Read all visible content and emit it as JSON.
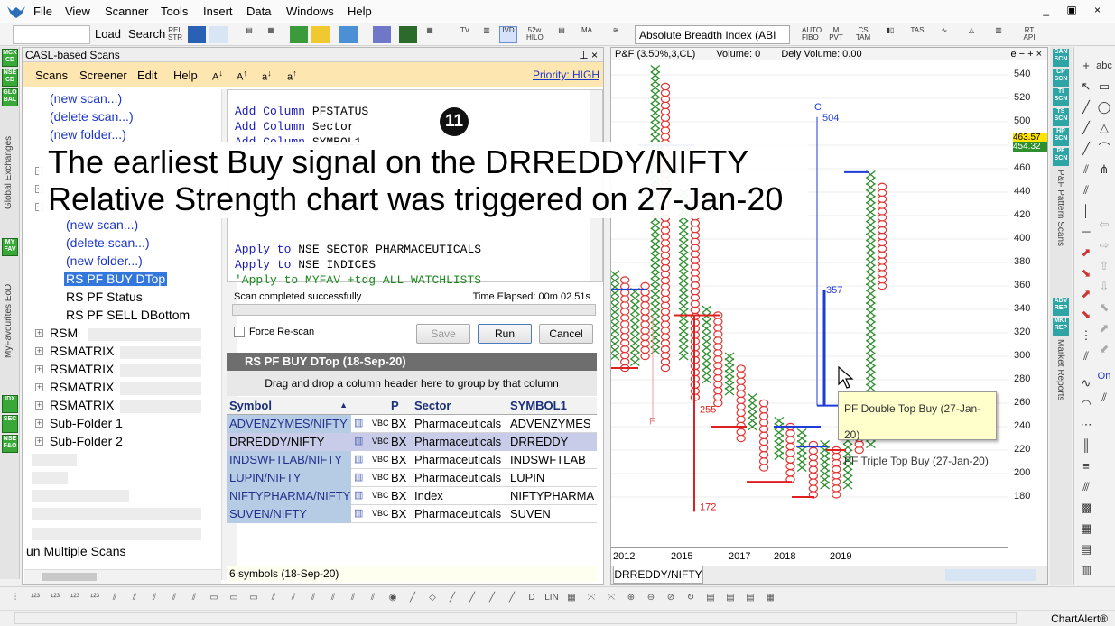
{
  "app": {
    "menu": [
      "File",
      "View",
      "Scanner",
      "Tools",
      "Insert",
      "Data",
      "Windows",
      "Help"
    ],
    "window_controls": "_ ▣ ×",
    "status_text": "ChartAlert®"
  },
  "toolbar": {
    "load_label": "Load",
    "search_label": "Search",
    "formula_value": "Absolute Breadth Index (ABI"
  },
  "left_strip": {
    "badges": [
      "MCX CD",
      "NSE CD",
      "GLO BAL",
      "MY FAV",
      "IDX",
      "SEC",
      "NSE F&O"
    ],
    "vertical_labels": [
      "Global Exchanges",
      "MyFavourites EoD"
    ]
  },
  "casl": {
    "panel_title": "CASL-based Scans",
    "menu": [
      "Scans",
      "Screener",
      "Edit",
      "Help"
    ],
    "priority": "Priority: HIGH",
    "tree": {
      "top_actions": [
        "(new scan...)",
        "(delete scan...)",
        "(new folder...)"
      ],
      "sub_actions": [
        "(new scan...)",
        "(delete scan...)",
        "(new folder...)"
      ],
      "scans": [
        "RS PF BUY DTop",
        "RS PF Status",
        "RS PF SELL DBottom"
      ],
      "folders": [
        "RSM",
        "RSMATRIX",
        "RSMATRIX",
        "RSMATRIX",
        "RSMATRIX",
        "Sub-Folder 1",
        "Sub-Folder 2"
      ],
      "run_multiple": "un Multiple Scans"
    },
    "code": [
      {
        "kw": "Add Column",
        "arg": "PFSTATUS"
      },
      {
        "kw": "Add Column",
        "arg": "Sector"
      },
      {
        "kw": "Add Column",
        "arg": "SYMBOL1"
      },
      {
        "kw": "Apply to",
        "arg": "NSE SECTOR PHARMACEUTICALS"
      },
      {
        "kw": "Apply to",
        "arg": "NSE INDICES"
      },
      {
        "kw": "'Apply to",
        "arg": "MYFAV +tdg ALL WATCHLISTS"
      }
    ],
    "step_number": "11",
    "status": "Scan completed successfully",
    "elapsed": "Time Elapsed: 00m 02.51s",
    "force_rescan": "Force Re-scan",
    "buttons": {
      "save": "Save",
      "run": "Run",
      "cancel": "Cancel"
    },
    "results_title": "RS PF BUY DTop (18-Sep-20)",
    "group_hint": "Drag and drop a column header here to group by that column",
    "columns": [
      "Symbol",
      "P",
      "Sector",
      "SYMBOL1"
    ],
    "rows": [
      {
        "symbol": "ADVENZYMES/NIFTY",
        "p": "BX",
        "sector": "Pharmaceuticals",
        "symbol1": "ADVENZYMES"
      },
      {
        "symbol": "DRREDDY/NIFTY",
        "p": "BX",
        "sector": "Pharmaceuticals",
        "symbol1": "DRREDDY"
      },
      {
        "symbol": "INDSWFTLAB/NIFTY",
        "p": "BX",
        "sector": "Pharmaceuticals",
        "symbol1": "INDSWFTLAB"
      },
      {
        "symbol": "LUPIN/NIFTY",
        "p": "BX",
        "sector": "Pharmaceuticals",
        "symbol1": "LUPIN"
      },
      {
        "symbol": "NIFTYPHARMA/NIFTY",
        "p": "BX",
        "sector": "Index",
        "symbol1": "NIFTYPHARMA"
      },
      {
        "symbol": "SUVEN/NIFTY",
        "p": "BX",
        "sector": "Pharmaceuticals",
        "symbol1": "SUVEN"
      }
    ],
    "row_icon_text": "VBC",
    "footer": "6 symbols (18-Sep-20)"
  },
  "chart": {
    "header": "P&F (3.50%,3,CL)",
    "volume": "Volume: 0",
    "dvolume": "Dely Volume: 0.00",
    "win_btns": "e − + ×",
    "tab": "DRREDDY/NIFTY",
    "price_badges": [
      "463.57",
      "454.32"
    ],
    "annotations": [
      "504",
      "357",
      "255",
      "172",
      "C",
      "F"
    ],
    "tooltip": [
      "PF Double Top Buy (27-Jan-20)",
      "PF Triple Top Buy (27-Jan-20)"
    ]
  },
  "chart_data": {
    "type": "point-and-figure",
    "title": "P&F (3.50%,3,CL)",
    "ylim": [
      165,
      550
    ],
    "yticks": [
      180,
      200,
      220,
      240,
      260,
      280,
      300,
      320,
      340,
      360,
      380,
      400,
      420,
      440,
      460,
      480,
      500,
      520,
      540
    ],
    "xticks": [
      "2012",
      "2015",
      "2017",
      "2018",
      "2019"
    ],
    "columns": [
      {
        "type": "X",
        "low": 300,
        "high": 370
      },
      {
        "type": "O",
        "low": 290,
        "high": 365
      },
      {
        "type": "X",
        "low": 295,
        "high": 355
      },
      {
        "type": "O",
        "low": 300,
        "high": 360
      },
      {
        "type": "X",
        "low": 305,
        "high": 545
      },
      {
        "type": "O",
        "low": 290,
        "high": 530
      },
      {
        "type": "X",
        "low": 300,
        "high": 445
      },
      {
        "type": "O",
        "low": 265,
        "high": 435
      },
      {
        "type": "X",
        "low": 280,
        "high": 340
      },
      {
        "type": "O",
        "low": 260,
        "high": 335
      },
      {
        "type": "X",
        "low": 270,
        "high": 300
      },
      {
        "type": "O",
        "low": 230,
        "high": 295
      },
      {
        "type": "X",
        "low": 240,
        "high": 265
      },
      {
        "type": "O",
        "low": 205,
        "high": 260
      },
      {
        "type": "X",
        "low": 215,
        "high": 245
      },
      {
        "type": "O",
        "low": 195,
        "high": 240
      },
      {
        "type": "X",
        "low": 205,
        "high": 235
      },
      {
        "type": "O",
        "low": 182,
        "high": 230
      },
      {
        "type": "X",
        "low": 190,
        "high": 225
      },
      {
        "type": "O",
        "low": 182,
        "high": 220
      },
      {
        "type": "X",
        "low": 190,
        "high": 255
      },
      {
        "type": "O",
        "low": 220,
        "high": 250
      },
      {
        "type": "X",
        "low": 225,
        "high": 455
      },
      {
        "type": "O",
        "low": 360,
        "high": 450
      }
    ],
    "lines": [
      {
        "color": "blue",
        "kind": "vertical",
        "from": 258,
        "to": 504,
        "label": "504"
      },
      {
        "color": "blue",
        "kind": "vertical",
        "from": 258,
        "to": 357,
        "label": "357"
      },
      {
        "color": "red",
        "kind": "vertical",
        "from": 172,
        "to": 335,
        "label": "255"
      },
      {
        "color": "red",
        "kind": "vertical",
        "from": 172,
        "to": 335,
        "label": "172"
      }
    ]
  },
  "right_strip": {
    "badges": [
      "CAN SCN",
      "CP SCN",
      "TI SCN",
      "TS SCN",
      "HP SCN",
      "PF SCN",
      "ADV REP",
      "MKT REP"
    ],
    "labels": [
      "P&F Pattern Scans",
      "Market Reports"
    ]
  },
  "overlay_caption": [
    "The earliest Buy signal on the DRREDDY/NIFTY",
    "Relative Strength chart was triggered on 27-Jan-20"
  ]
}
